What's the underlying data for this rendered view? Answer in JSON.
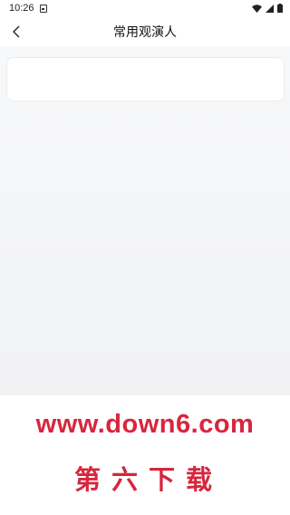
{
  "status_bar": {
    "time": "10:26",
    "icons": [
      "sim-icon",
      "wifi-icon",
      "signal-icon",
      "battery-icon"
    ]
  },
  "nav": {
    "title": "常用观演人",
    "back_icon": "chevron-left-icon"
  },
  "content": {
    "card_text": ""
  },
  "watermark": {
    "url": "www.down6.com",
    "name": "第六下载"
  },
  "colors": {
    "background": "#f4f5f7",
    "card": "#ffffff",
    "watermark_red": "#d7263d"
  }
}
